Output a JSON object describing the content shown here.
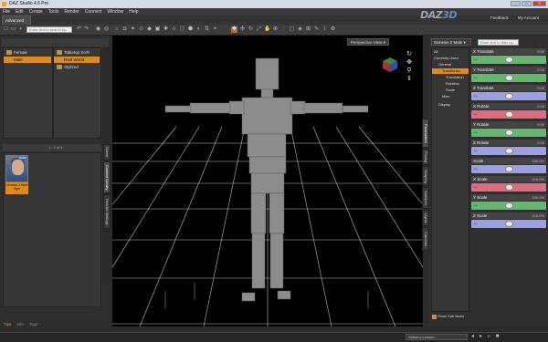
{
  "window": {
    "title": "DAZ Studio 4.6 Pro",
    "min": "_",
    "max": "□",
    "close": "✕"
  },
  "menu": [
    "File",
    "Edit",
    "Create",
    "Tools",
    "Render",
    "Connect",
    "Window",
    "Help"
  ],
  "brand": {
    "logo_a": "DAZ",
    "logo_b": "3D",
    "links": [
      "Feedback",
      "My Account"
    ]
  },
  "tabs": {
    "active": "Advanced"
  },
  "toolbar": {
    "search_placeholder": "Enter text to search by..."
  },
  "left_panel": {
    "categories": [
      {
        "label": "Female",
        "selected": false
      },
      {
        "label": "Male",
        "selected": true
      }
    ],
    "subcategories": [
      {
        "label": "Tabletop SciFi",
        "selected": false
      },
      {
        "label": "Real World",
        "selected": true
      },
      {
        "label": "Stylized",
        "selected": false
      }
    ],
    "pagination": "1 - 1 of 1",
    "vertical_tabs": [
      "Scene",
      "Content Library",
      "Render Settings"
    ],
    "items": [
      {
        "label": "Genesis 2 Male Style",
        "badge": "Actor"
      }
    ],
    "bottom_tabs": [
      "Tips",
      "Info",
      "Tags"
    ]
  },
  "viewport": {
    "camera": "Perspective View"
  },
  "right_panel": {
    "selected_node": "Genesis 2 Male",
    "filter_placeholder": "Enter text to filter by...",
    "vertical_tabs": [
      "Parameters",
      "Posing",
      "Shaping",
      "Surfaces",
      "Lights",
      "Cameras"
    ],
    "tree": [
      {
        "label": "All",
        "level": 0,
        "selected": false
      },
      {
        "label": "Currently Used",
        "level": 0,
        "selected": false
      },
      {
        "label": "General",
        "level": 1,
        "selected": false
      },
      {
        "label": "Transforms",
        "level": 2,
        "selected": true
      },
      {
        "label": "Translation",
        "level": 3,
        "selected": false
      },
      {
        "label": "Rotation",
        "level": 3,
        "selected": false
      },
      {
        "label": "Scale",
        "level": 3,
        "selected": false
      },
      {
        "label": "Misc",
        "level": 2,
        "selected": false
      },
      {
        "label": "Display",
        "level": 1,
        "selected": false
      }
    ],
    "parameters": [
      {
        "label": "X Translate",
        "value": "0.00",
        "color": "#62b96a",
        "pos": 0.5
      },
      {
        "label": "Y Translate",
        "value": "0.00",
        "color": "#62b96a",
        "pos": 0.5
      },
      {
        "label": "Z Translate",
        "value": "0.00",
        "color": "#9aa0e0",
        "pos": 0.5
      },
      {
        "label": "X Rotate",
        "value": "0.00",
        "color": "#e06a7e",
        "pos": 0.5
      },
      {
        "label": "Y Rotate",
        "value": "0.00",
        "color": "#62b96a",
        "pos": 0.5
      },
      {
        "label": "Z Rotate",
        "value": "0.00",
        "color": "#9aa0e0",
        "pos": 0.5
      },
      {
        "label": "Scale",
        "value": "100.0%",
        "color": "#9aa0e0",
        "pos": 0.5
      },
      {
        "label": "X Scale",
        "value": "100.0%",
        "color": "#e06a7e",
        "pos": 0.5
      },
      {
        "label": "Y Scale",
        "value": "100.0%",
        "color": "#62b96a",
        "pos": 0.5
      },
      {
        "label": "Z Scale",
        "value": "100.0%",
        "color": "#9aa0e0",
        "pos": 0.5
      }
    ],
    "show_sub_items": "Show Sub Items"
  },
  "statusbar": {
    "lesson_placeholder": "Select a Lesson..."
  }
}
